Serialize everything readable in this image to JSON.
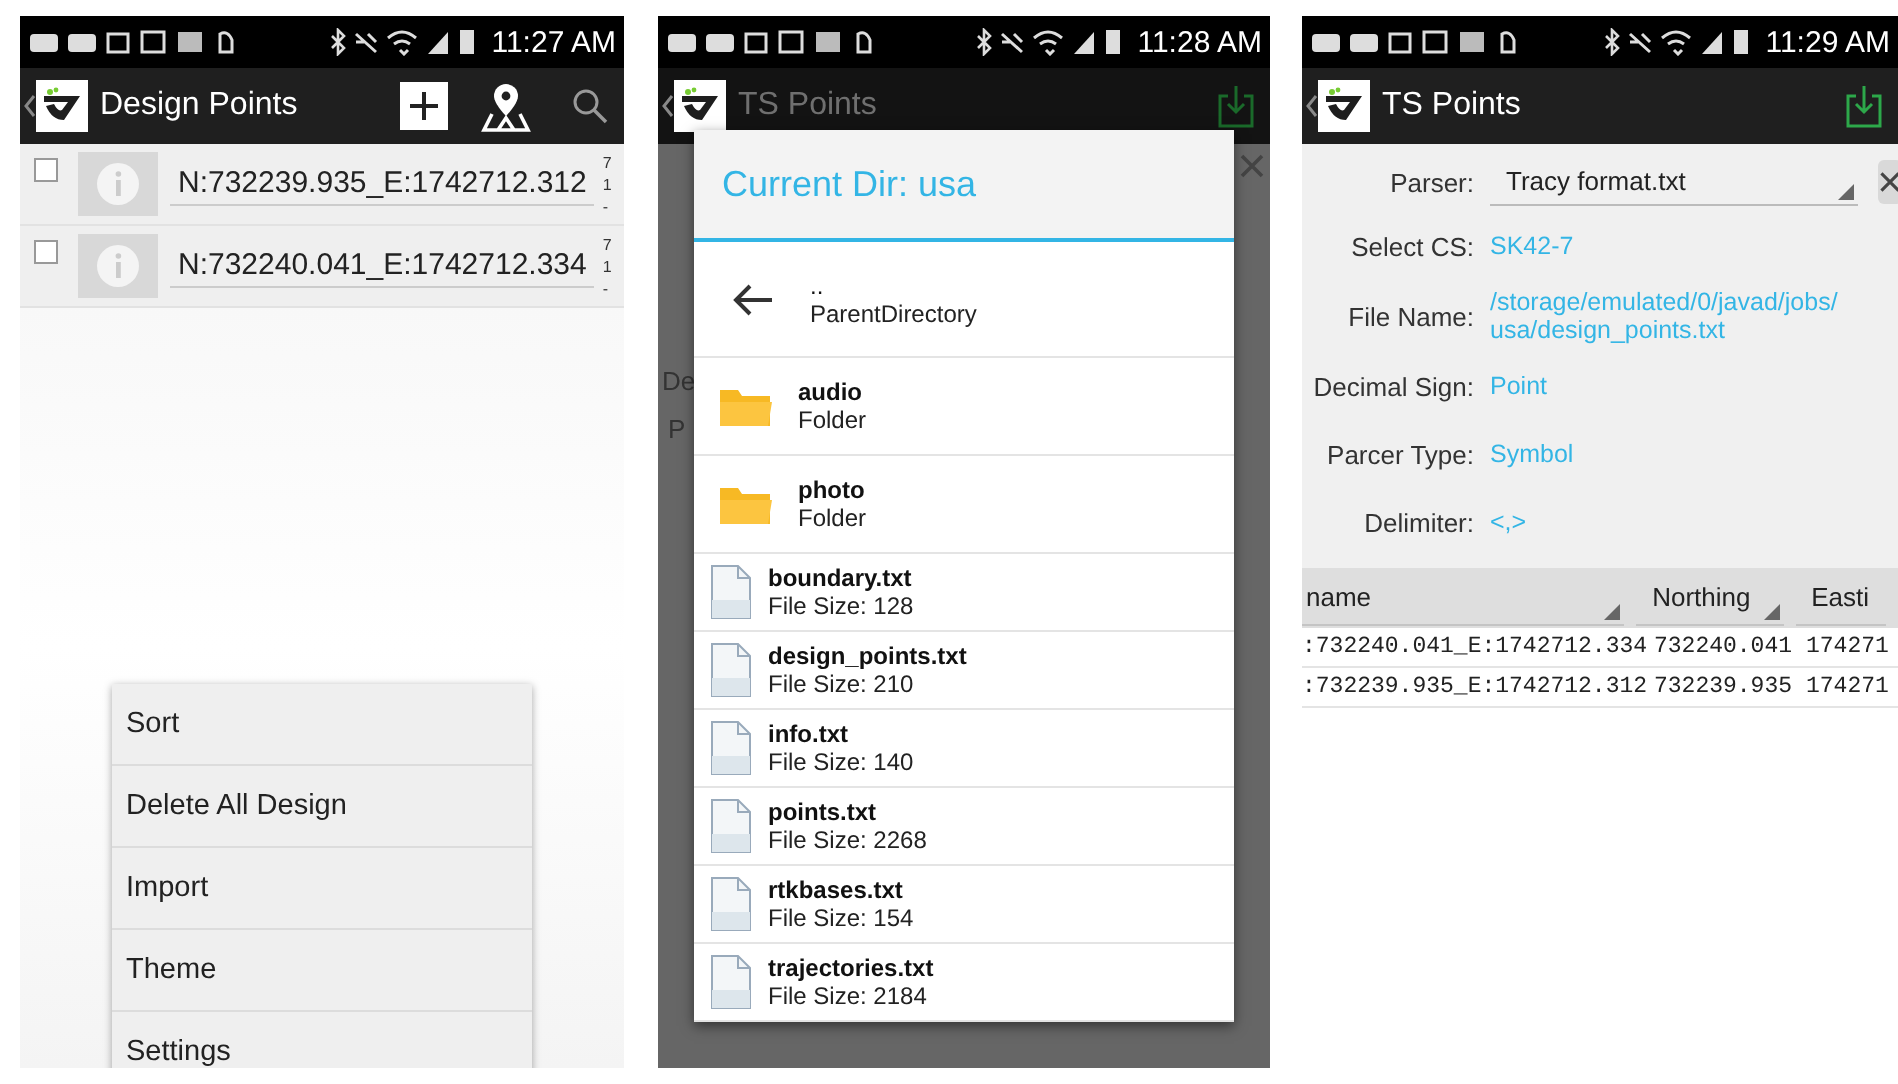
{
  "design_screen": {
    "status_bar": {
      "time": "11:27 AM"
    },
    "toolbar": {
      "title": "Design Points"
    },
    "points": [
      {
        "name": "N:732239.935_E:1742712.312",
        "checked": false,
        "side_lines": [
          "7",
          "1",
          "-"
        ]
      },
      {
        "name": "N:732240.041_E:1742712.334",
        "checked": false,
        "side_lines": [
          "7",
          "1",
          "-"
        ]
      }
    ],
    "menu": [
      "Sort",
      "Delete All Design",
      "Import",
      "Theme",
      "Settings"
    ]
  },
  "file_dialog_screen": {
    "status_bar": {
      "time": "11:28 AM"
    },
    "toolbar": {
      "title": "TS Points"
    },
    "background_texts": [
      "De",
      "P"
    ],
    "dialog": {
      "title": "Current Dir: usa",
      "entries": [
        {
          "kind": "parent",
          "name": "..",
          "detail": "ParentDirectory"
        },
        {
          "kind": "folder",
          "name": "audio",
          "detail": "Folder"
        },
        {
          "kind": "folder",
          "name": "photo",
          "detail": "Folder"
        },
        {
          "kind": "file",
          "name": "boundary.txt",
          "detail": "File Size: 128"
        },
        {
          "kind": "file",
          "name": "design_points.txt",
          "detail": "File Size: 210"
        },
        {
          "kind": "file",
          "name": "info.txt",
          "detail": "File Size: 140"
        },
        {
          "kind": "file",
          "name": "points.txt",
          "detail": "File Size: 2268"
        },
        {
          "kind": "file",
          "name": "rtkbases.txt",
          "detail": "File Size: 154"
        },
        {
          "kind": "file",
          "name": "trajectories.txt",
          "detail": "File Size: 2184"
        }
      ]
    }
  },
  "ts_points_screen": {
    "status_bar": {
      "time": "11:29 AM"
    },
    "toolbar": {
      "title": "TS Points"
    },
    "form": [
      {
        "kind": "dropdown",
        "label": "Parser:",
        "value": "Tracy format.txt"
      },
      {
        "kind": "link",
        "label": "Select CS:",
        "value": "SK42-7"
      },
      {
        "kind": "link",
        "label": "File Name:",
        "value": "/storage/emulated/0/javad/jobs/usa/design_points.txt"
      },
      {
        "kind": "link",
        "label": "Decimal Sign:",
        "value": "Point"
      },
      {
        "kind": "link",
        "label": "Parcer Type:",
        "value": "Symbol"
      },
      {
        "kind": "link",
        "label": "Delimiter:",
        "value": "<,>"
      }
    ],
    "table": {
      "columns": [
        "name",
        "Northing",
        "Easti"
      ],
      "rows": [
        [
          ":732240.041_E:1742712.334",
          "732240.041",
          "174271"
        ],
        [
          ":732239.935_E:1742712.312",
          "732239.935",
          "174271"
        ]
      ]
    }
  }
}
